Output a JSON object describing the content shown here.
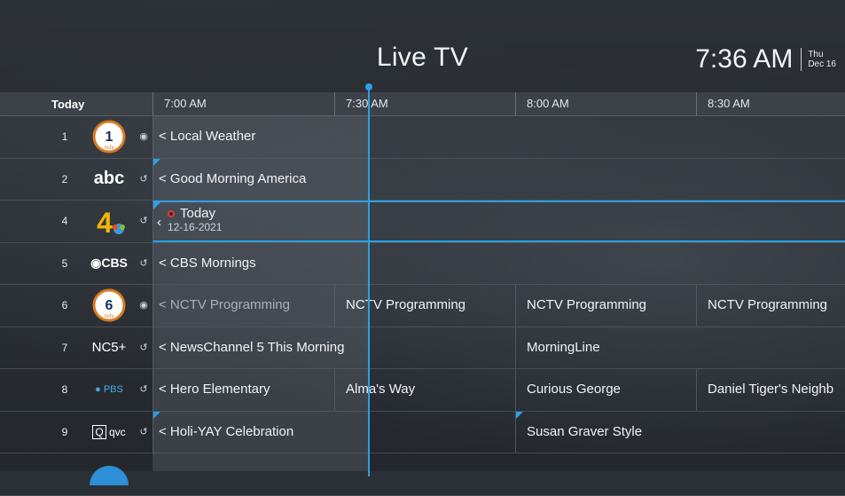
{
  "header": {
    "title": "Live TV",
    "clock_time": "7:36 AM",
    "clock_day": "Thu",
    "clock_date": "Dec 16"
  },
  "timebar": {
    "today_label": "Today",
    "slots": [
      "7:00 AM",
      "7:30 AM",
      "8:00 AM",
      "8:30 AM"
    ]
  },
  "colors": {
    "accent": "#2aa0e8",
    "record": "#e23b3b"
  },
  "channels": [
    {
      "number": "1",
      "logo_icon": "nctv-1-logo-icon",
      "status_icon": "record-dot-icon",
      "programs": [
        {
          "title": "< Local Weather"
        }
      ]
    },
    {
      "number": "2",
      "logo_icon": "abc-logo-icon",
      "logo_text": "abc",
      "status_icon": "replay-icon",
      "programs": [
        {
          "title": "< Good Morning America"
        }
      ]
    },
    {
      "number": "4",
      "logo_icon": "nbc-4-logo-icon",
      "status_icon": "replay-icon",
      "programs": [
        {
          "title": "Today",
          "subtitle": "12-16-2021",
          "recording": true
        }
      ]
    },
    {
      "number": "5",
      "logo_icon": "cbs-logo-icon",
      "logo_text": "CBS",
      "status_icon": "replay-icon",
      "programs": [
        {
          "title": "< CBS Mornings"
        }
      ]
    },
    {
      "number": "6",
      "logo_icon": "nctv-6-logo-icon",
      "status_icon": "record-dot-icon",
      "programs": [
        {
          "title": "< NCTV Programming"
        },
        {
          "title": "NCTV Programming"
        },
        {
          "title": "NCTV Programming"
        },
        {
          "title": "NCTV Programming"
        }
      ]
    },
    {
      "number": "7",
      "logo_icon": "nc5-plus-logo-icon",
      "logo_text": "NC5+",
      "status_icon": "replay-icon",
      "programs": [
        {
          "title": "< NewsChannel 5 This Morning"
        },
        {
          "title": "MorningLine"
        }
      ]
    },
    {
      "number": "8",
      "logo_icon": "pbs-logo-icon",
      "logo_text": "PBS",
      "status_icon": "replay-icon",
      "programs": [
        {
          "title": "< Hero Elementary"
        },
        {
          "title": "Alma's Way"
        },
        {
          "title": "Curious George"
        },
        {
          "title": "Daniel Tiger's Neighb"
        }
      ]
    },
    {
      "number": "9",
      "logo_icon": "qvc-logo-icon",
      "logo_text": "qvc",
      "status_icon": "replay-icon",
      "programs": [
        {
          "title": "< Holi-YAY Celebration"
        },
        {
          "title": "Susan Graver Style"
        }
      ]
    }
  ]
}
